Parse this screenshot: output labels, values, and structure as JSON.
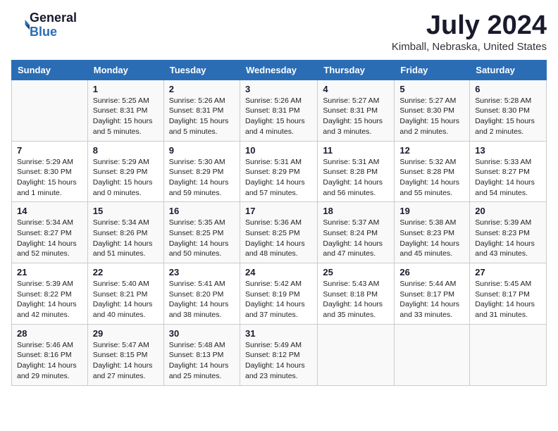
{
  "header": {
    "logo": {
      "general": "General",
      "blue": "Blue"
    },
    "title": "July 2024",
    "location": "Kimball, Nebraska, United States"
  },
  "days_of_week": [
    "Sunday",
    "Monday",
    "Tuesday",
    "Wednesday",
    "Thursday",
    "Friday",
    "Saturday"
  ],
  "weeks": [
    [
      {
        "day": "",
        "detail": ""
      },
      {
        "day": "1",
        "detail": "Sunrise: 5:25 AM\nSunset: 8:31 PM\nDaylight: 15 hours\nand 5 minutes."
      },
      {
        "day": "2",
        "detail": "Sunrise: 5:26 AM\nSunset: 8:31 PM\nDaylight: 15 hours\nand 5 minutes."
      },
      {
        "day": "3",
        "detail": "Sunrise: 5:26 AM\nSunset: 8:31 PM\nDaylight: 15 hours\nand 4 minutes."
      },
      {
        "day": "4",
        "detail": "Sunrise: 5:27 AM\nSunset: 8:31 PM\nDaylight: 15 hours\nand 3 minutes."
      },
      {
        "day": "5",
        "detail": "Sunrise: 5:27 AM\nSunset: 8:30 PM\nDaylight: 15 hours\nand 2 minutes."
      },
      {
        "day": "6",
        "detail": "Sunrise: 5:28 AM\nSunset: 8:30 PM\nDaylight: 15 hours\nand 2 minutes."
      }
    ],
    [
      {
        "day": "7",
        "detail": "Sunrise: 5:29 AM\nSunset: 8:30 PM\nDaylight: 15 hours\nand 1 minute."
      },
      {
        "day": "8",
        "detail": "Sunrise: 5:29 AM\nSunset: 8:29 PM\nDaylight: 15 hours\nand 0 minutes."
      },
      {
        "day": "9",
        "detail": "Sunrise: 5:30 AM\nSunset: 8:29 PM\nDaylight: 14 hours\nand 59 minutes."
      },
      {
        "day": "10",
        "detail": "Sunrise: 5:31 AM\nSunset: 8:29 PM\nDaylight: 14 hours\nand 57 minutes."
      },
      {
        "day": "11",
        "detail": "Sunrise: 5:31 AM\nSunset: 8:28 PM\nDaylight: 14 hours\nand 56 minutes."
      },
      {
        "day": "12",
        "detail": "Sunrise: 5:32 AM\nSunset: 8:28 PM\nDaylight: 14 hours\nand 55 minutes."
      },
      {
        "day": "13",
        "detail": "Sunrise: 5:33 AM\nSunset: 8:27 PM\nDaylight: 14 hours\nand 54 minutes."
      }
    ],
    [
      {
        "day": "14",
        "detail": "Sunrise: 5:34 AM\nSunset: 8:27 PM\nDaylight: 14 hours\nand 52 minutes."
      },
      {
        "day": "15",
        "detail": "Sunrise: 5:34 AM\nSunset: 8:26 PM\nDaylight: 14 hours\nand 51 minutes."
      },
      {
        "day": "16",
        "detail": "Sunrise: 5:35 AM\nSunset: 8:25 PM\nDaylight: 14 hours\nand 50 minutes."
      },
      {
        "day": "17",
        "detail": "Sunrise: 5:36 AM\nSunset: 8:25 PM\nDaylight: 14 hours\nand 48 minutes."
      },
      {
        "day": "18",
        "detail": "Sunrise: 5:37 AM\nSunset: 8:24 PM\nDaylight: 14 hours\nand 47 minutes."
      },
      {
        "day": "19",
        "detail": "Sunrise: 5:38 AM\nSunset: 8:23 PM\nDaylight: 14 hours\nand 45 minutes."
      },
      {
        "day": "20",
        "detail": "Sunrise: 5:39 AM\nSunset: 8:23 PM\nDaylight: 14 hours\nand 43 minutes."
      }
    ],
    [
      {
        "day": "21",
        "detail": "Sunrise: 5:39 AM\nSunset: 8:22 PM\nDaylight: 14 hours\nand 42 minutes."
      },
      {
        "day": "22",
        "detail": "Sunrise: 5:40 AM\nSunset: 8:21 PM\nDaylight: 14 hours\nand 40 minutes."
      },
      {
        "day": "23",
        "detail": "Sunrise: 5:41 AM\nSunset: 8:20 PM\nDaylight: 14 hours\nand 38 minutes."
      },
      {
        "day": "24",
        "detail": "Sunrise: 5:42 AM\nSunset: 8:19 PM\nDaylight: 14 hours\nand 37 minutes."
      },
      {
        "day": "25",
        "detail": "Sunrise: 5:43 AM\nSunset: 8:18 PM\nDaylight: 14 hours\nand 35 minutes."
      },
      {
        "day": "26",
        "detail": "Sunrise: 5:44 AM\nSunset: 8:17 PM\nDaylight: 14 hours\nand 33 minutes."
      },
      {
        "day": "27",
        "detail": "Sunrise: 5:45 AM\nSunset: 8:17 PM\nDaylight: 14 hours\nand 31 minutes."
      }
    ],
    [
      {
        "day": "28",
        "detail": "Sunrise: 5:46 AM\nSunset: 8:16 PM\nDaylight: 14 hours\nand 29 minutes."
      },
      {
        "day": "29",
        "detail": "Sunrise: 5:47 AM\nSunset: 8:15 PM\nDaylight: 14 hours\nand 27 minutes."
      },
      {
        "day": "30",
        "detail": "Sunrise: 5:48 AM\nSunset: 8:13 PM\nDaylight: 14 hours\nand 25 minutes."
      },
      {
        "day": "31",
        "detail": "Sunrise: 5:49 AM\nSunset: 8:12 PM\nDaylight: 14 hours\nand 23 minutes."
      },
      {
        "day": "",
        "detail": ""
      },
      {
        "day": "",
        "detail": ""
      },
      {
        "day": "",
        "detail": ""
      }
    ]
  ]
}
